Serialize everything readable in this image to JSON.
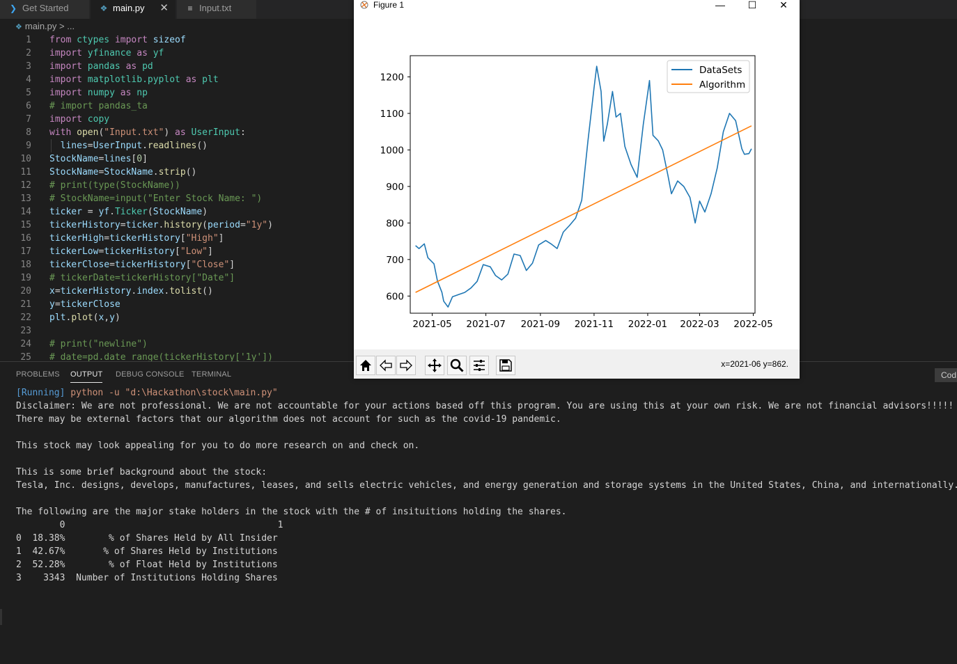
{
  "tabs": [
    {
      "label": "Get Started",
      "icon": "vscode-icon"
    },
    {
      "label": "main.py",
      "icon": "python-file-icon",
      "active": true
    },
    {
      "label": "Input.txt",
      "icon": "text-file-icon"
    }
  ],
  "breadcrumb": {
    "file": "main.py",
    "sep": ">",
    "rest": "..."
  },
  "panel": {
    "tabs": [
      "PROBLEMS",
      "OUTPUT",
      "DEBUG CONSOLE",
      "TERMINAL"
    ],
    "code_button": "Cod",
    "output": {
      "running": "[Running]",
      "command": " python -u \"d:\\Hackathon\\stock\\main.py\"",
      "lines": [
        "Disclaimer: We are not professional. We are not accountable for your actions based off this program. You are using this at your own risk. We are not financial advisors!!!!!",
        "There may be external factors that our algorithm does not account for such as the covid-19 pandemic.",
        "",
        "This stock may look appealing for you to do more research on and check on.",
        "",
        "This is some brief background about the stock:",
        "Tesla, Inc. designs, develops, manufactures, leases, and sells electric vehicles, and energy generation and storage systems in the United States, China, and internationally. Th",
        "",
        "The following are the major stake holders in the stock with the # of insituitions holding the shares.",
        "        0                                       1",
        "0  18.38%        % of Shares Held by All Insider",
        "1  42.67%       % of Shares Held by Institutions",
        "2  52.28%        % of Float Held by Institutions",
        "3    3343  Number of Institutions Holding Shares"
      ]
    }
  },
  "figure": {
    "title": "Figure 1",
    "coords": "x=2021-06 y=862.",
    "window_buttons": {
      "minimize": "—",
      "maximize": "☐",
      "close": "✕"
    }
  },
  "chart_data": {
    "type": "line",
    "title": "",
    "xlabel": "",
    "ylabel": "",
    "x_ticks": [
      "2021-05",
      "2021-07",
      "2021-09",
      "2021-11",
      "2022-01",
      "2022-03",
      "2022-05"
    ],
    "y_ticks": [
      600,
      700,
      800,
      900,
      1000,
      1100,
      1200
    ],
    "xlim": [
      "2021-04-06",
      "2022-05-03"
    ],
    "ylim": [
      553,
      1258
    ],
    "legend_position": "top-right",
    "grid": false,
    "series": [
      {
        "name": "DataSets",
        "color": "#1f77b4",
        "x": [
          "2021-04-12",
          "2021-04-16",
          "2021-04-22",
          "2021-04-26",
          "2021-05-03",
          "2021-05-07",
          "2021-05-12",
          "2021-05-14",
          "2021-05-19",
          "2021-05-24",
          "2021-06-01",
          "2021-06-07",
          "2021-06-14",
          "2021-06-21",
          "2021-06-28",
          "2021-07-06",
          "2021-07-12",
          "2021-07-19",
          "2021-07-26",
          "2021-08-02",
          "2021-08-09",
          "2021-08-16",
          "2021-08-23",
          "2021-08-30",
          "2021-09-07",
          "2021-09-13",
          "2021-09-20",
          "2021-09-27",
          "2021-10-04",
          "2021-10-11",
          "2021-10-18",
          "2021-10-25",
          "2021-11-01",
          "2021-11-04",
          "2021-11-09",
          "2021-11-12",
          "2021-11-16",
          "2021-11-22",
          "2021-11-26",
          "2021-12-01",
          "2021-12-06",
          "2021-12-13",
          "2021-12-20",
          "2021-12-27",
          "2022-01-03",
          "2022-01-07",
          "2022-01-13",
          "2022-01-18",
          "2022-01-24",
          "2022-01-28",
          "2022-02-04",
          "2022-02-11",
          "2022-02-18",
          "2022-02-24",
          "2022-03-01",
          "2022-03-07",
          "2022-03-14",
          "2022-03-21",
          "2022-03-28",
          "2022-04-04",
          "2022-04-11",
          "2022-04-18",
          "2022-04-21",
          "2022-04-26",
          "2022-04-29"
        ],
        "y": [
          738,
          730,
          743,
          705,
          688,
          641,
          610,
          586,
          570,
          598,
          605,
          610,
          622,
          640,
          686,
          680,
          656,
          644,
          660,
          715,
          711,
          670,
          690,
          740,
          752,
          743,
          730,
          775,
          793,
          813,
          862,
          1024,
          1170,
          1229,
          1160,
          1024,
          1070,
          1160,
          1090,
          1100,
          1010,
          960,
          925,
          1070,
          1190,
          1040,
          1025,
          1000,
          930,
          880,
          915,
          900,
          870,
          800,
          860,
          830,
          880,
          950,
          1050,
          1100,
          1080,
          1003,
          988,
          990,
          1003
        ]
      },
      {
        "name": "Algorithm",
        "color": "#ff7f0e",
        "x": [
          "2021-04-12",
          "2022-04-29"
        ],
        "y": [
          610,
          1066
        ]
      }
    ]
  }
}
